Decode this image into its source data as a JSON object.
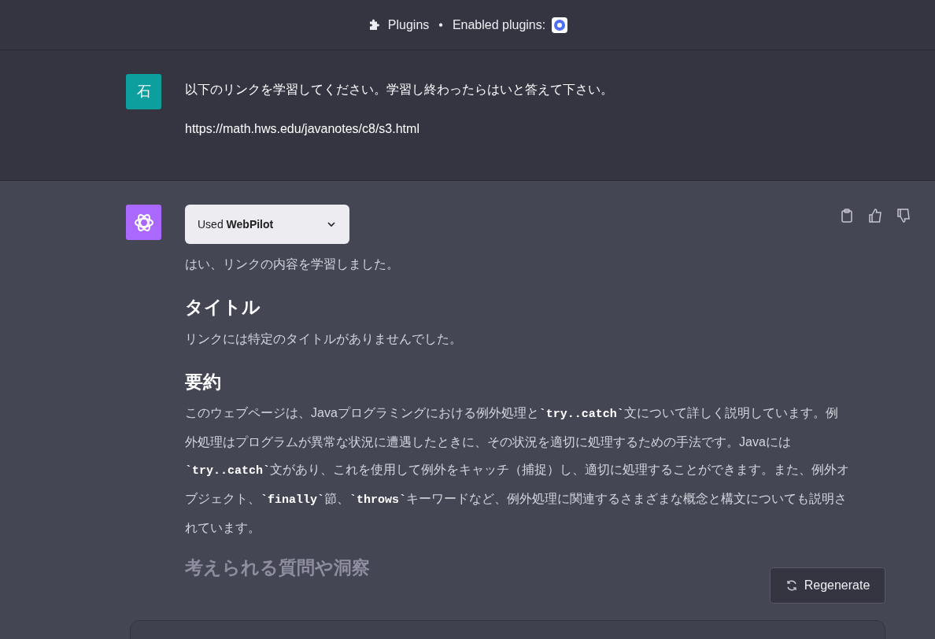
{
  "header": {
    "plugins_label": "Plugins",
    "separator": "•",
    "enabled_label": "Enabled plugins:"
  },
  "user_message": {
    "avatar": "石",
    "lines": [
      "以下のリンクを学習してください。学習し終わったらはいと答えて下さい。",
      "https://math.hws.edu/javanotes/c8/s3.html"
    ]
  },
  "assistant_message": {
    "plugin_used": {
      "prefix": "Used",
      "name": "WebPilot",
      "expanded": false
    },
    "blocks": [
      {
        "kind": "paragraph",
        "text": "はい、リンクの内容を学習しました。"
      },
      {
        "kind": "heading",
        "text": "タイトル"
      },
      {
        "kind": "paragraph",
        "text": "リンクには特定のタイトルがありませんでした。"
      },
      {
        "kind": "heading",
        "text": "要約"
      },
      {
        "kind": "paragraph",
        "text": "このウェブページは、Javaプログラミングにおける例外処理と**`try..catch`**文について詳しく説明しています。例外処理はプログラムが異常な状況に遭遇したときに、その状況を適切に処理するための手法です。Javaには**`try..catch`**文があり、これを使用して例外をキャッチ（捕捉）し、適切に処理することができます。また、例外オブジェクト、**`finally`**節、**`throws`**キーワードなど、例外処理に関連するさまざまな概念と構文についても説明されています。"
      },
      {
        "kind": "heading",
        "text": "考えられる質問や洞察",
        "faded": true
      }
    ]
  },
  "regenerate_button": "Regenerate"
}
